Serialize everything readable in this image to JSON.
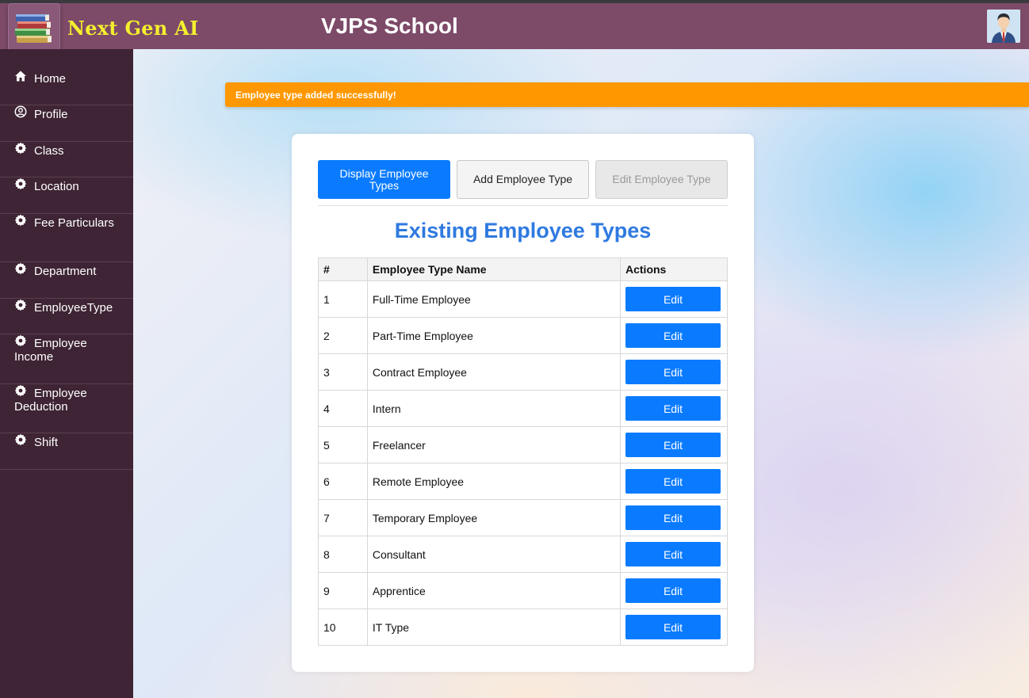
{
  "header": {
    "brand": "Next Gen AI",
    "school": "VJPS School",
    "logo_icon": "books-icon",
    "avatar_icon": "user-avatar-icon"
  },
  "sidebar": {
    "items": [
      {
        "label": "Home",
        "icon": "home-icon"
      },
      {
        "label": "Profile",
        "icon": "user-circle-icon"
      },
      {
        "label": "Class",
        "icon": "gear-icon"
      },
      {
        "label": "Location",
        "icon": "gear-icon"
      },
      {
        "label": "Fee Particulars",
        "icon": "gear-icon"
      },
      {
        "label": "Department",
        "icon": "gear-icon"
      },
      {
        "label": "EmployeeType",
        "icon": "gear-icon"
      },
      {
        "label": "Employee Income",
        "icon": "gear-icon"
      },
      {
        "label": "Employee Deduction",
        "icon": "gear-icon"
      },
      {
        "label": "Shift",
        "icon": "gear-icon"
      }
    ]
  },
  "alert": {
    "text": "Employee type added successfully!",
    "color": "#ff9800"
  },
  "tabs": {
    "display": "Display Employee Types",
    "add": "Add Employee Type",
    "edit": "Edit Employee Type"
  },
  "main": {
    "title": "Existing Employee Types",
    "columns": [
      "#",
      "Employee Type Name",
      "Actions"
    ],
    "edit_label": "Edit",
    "rows": [
      {
        "num": "1",
        "name": "Full-Time Employee"
      },
      {
        "num": "2",
        "name": "Part-Time Employee"
      },
      {
        "num": "3",
        "name": "Contract Employee"
      },
      {
        "num": "4",
        "name": "Intern"
      },
      {
        "num": "5",
        "name": "Freelancer"
      },
      {
        "num": "6",
        "name": "Remote Employee"
      },
      {
        "num": "7",
        "name": "Temporary Employee"
      },
      {
        "num": "8",
        "name": "Consultant"
      },
      {
        "num": "9",
        "name": "Apprentice"
      },
      {
        "num": "10",
        "name": "IT Type"
      }
    ]
  },
  "colors": {
    "header_bg": "#7d4a68",
    "brand_text": "#f4ef2e",
    "sidebar_bg": "#3e2434",
    "accent_blue": "#0a7bff",
    "title_blue": "#2f7ae0"
  }
}
